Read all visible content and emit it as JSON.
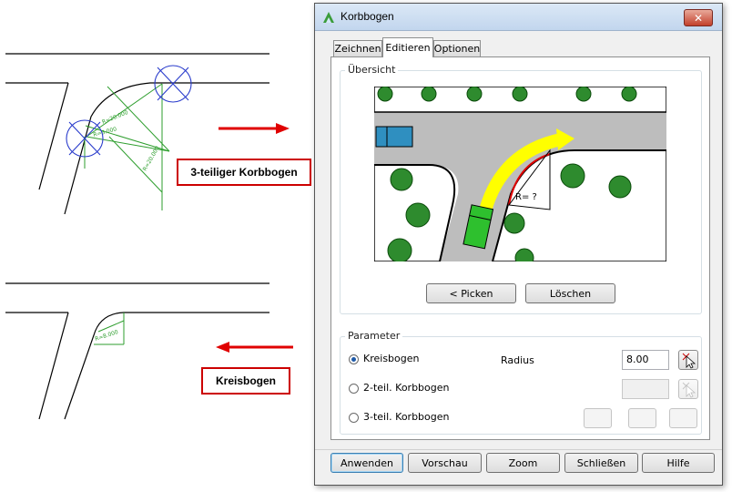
{
  "illustration": {
    "callout_top": "3-teiliger Korbbogen",
    "callout_bottom": "Kreisbogen",
    "dim_labels": [
      "R=20.000",
      "R=8.000",
      "R=20.000",
      "R=8.000"
    ]
  },
  "dialog": {
    "title": "Korbbogen",
    "close_glyph": "✕",
    "tabs": [
      {
        "label": "Zeichnen",
        "active": false
      },
      {
        "label": "Editieren",
        "active": true
      },
      {
        "label": "Optionen",
        "active": false
      }
    ],
    "overview": {
      "legend": "Übersicht",
      "preview_label": "R= ?",
      "pick_button": "< Picken",
      "delete_button": "Löschen"
    },
    "parameter": {
      "legend": "Parameter",
      "options": [
        {
          "label": "Kreisbogen",
          "selected": true
        },
        {
          "label": "2-teil. Korbbogen",
          "selected": false
        },
        {
          "label": "3-teil. Korbbogen",
          "selected": false
        }
      ],
      "radius_label": "Radius",
      "radius_value": "8.00"
    },
    "footer": {
      "apply": "Anwenden",
      "preview": "Vorschau",
      "zoom": "Zoom",
      "close": "Schließen",
      "help": "Hilfe"
    }
  },
  "colors": {
    "callout_border": "#cc0000",
    "arrow": "#e00000",
    "construction_green": "#2e9e2e",
    "construction_blue": "#2a3ccc",
    "road_gray": "#bdbdbd",
    "path_yellow": "#ffff00",
    "arc_red": "#e00000"
  }
}
